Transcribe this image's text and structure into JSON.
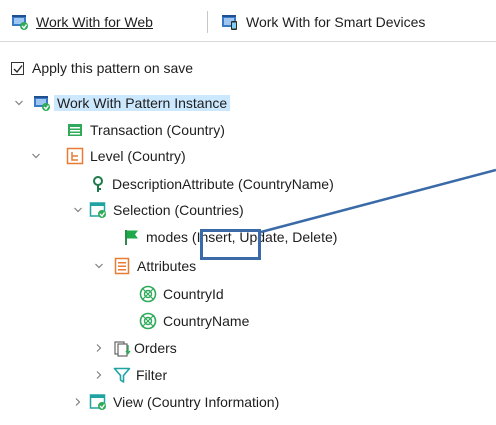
{
  "tabs": [
    {
      "label": "Work With for Web",
      "icon": "work-with-web-icon",
      "selected": true
    },
    {
      "label": "Work With for Smart Devices",
      "icon": "work-with-smart-devices-icon",
      "selected": false
    }
  ],
  "apply_on_save": {
    "label": "Apply this pattern on save",
    "checked": true
  },
  "tree": {
    "root": "Work With Pattern Instance",
    "transaction": "Transaction (Country)",
    "level": "Level (Country)",
    "description_attribute": "DescriptionAttribute (CountryName)",
    "selection": "Selection (Countries)",
    "modes": "modes (Insert, Update, Delete)",
    "attributes": "Attributes",
    "attribute_items": [
      "CountryId",
      "CountryName"
    ],
    "orders": "Orders",
    "filter": "Filter",
    "view": "View (Country Information)"
  },
  "colors": {
    "accent_blue": "#3b6aa8",
    "selection_bg": "#cce8ff",
    "icon_green": "#2eaa5a",
    "icon_orange": "#e87b35",
    "icon_teal": "#1fa3a3"
  }
}
